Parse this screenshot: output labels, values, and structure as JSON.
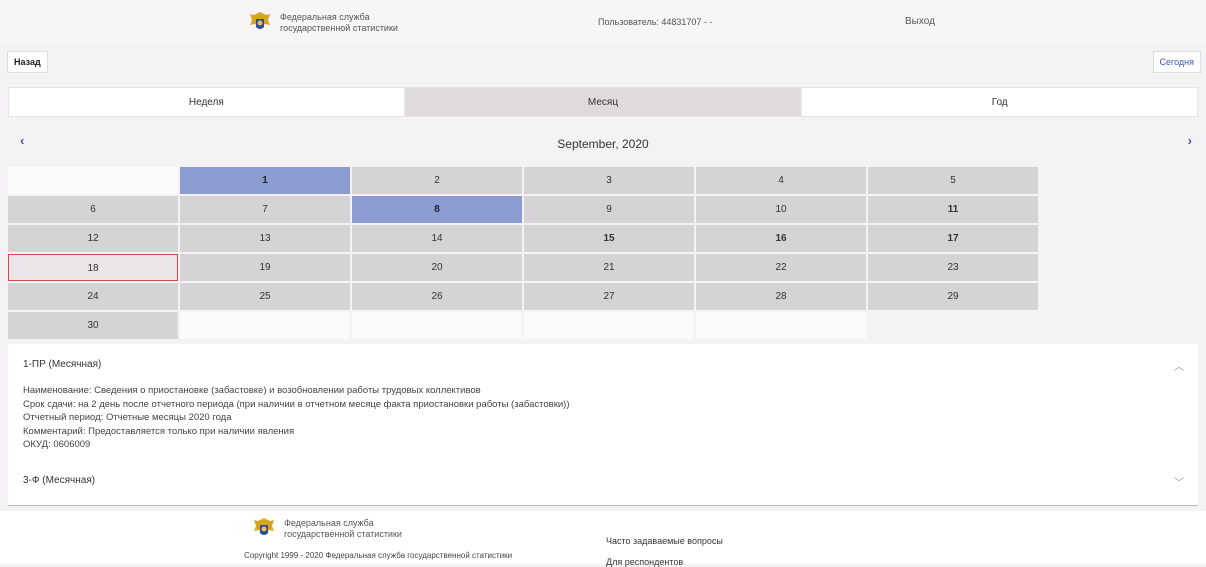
{
  "header": {
    "org_line1": "Федеральная служба",
    "org_line2": "государственной статистики",
    "user_label": "Пользователь: 44831707 - -",
    "logout_label": "Выход"
  },
  "nav": {
    "back_label": "Назад",
    "today_label": "Сегодня"
  },
  "tabs": [
    {
      "label": "Неделя"
    },
    {
      "label": "Месяц"
    },
    {
      "label": "Год"
    }
  ],
  "calendar": {
    "title": "September, 2020",
    "prev_icon": "chevron-left-icon",
    "next_icon": "chevron-right-icon",
    "selected_days": [
      1,
      8
    ],
    "highlighted_day": 18,
    "days": [
      "",
      "1",
      "2",
      "3",
      "4",
      "5",
      "6",
      "7",
      "8",
      "9",
      "10",
      "11",
      "12",
      "13",
      "14",
      "15",
      "16",
      "17",
      "18",
      "19",
      "20",
      "21",
      "22",
      "23",
      "24",
      "25",
      "26",
      "27",
      "28",
      "29",
      "30",
      "",
      "",
      "",
      ""
    ],
    "colors": {
      "selected": "#8c9bd0",
      "today_border": "#d04a4a",
      "day_cell": "#d6d3d6"
    }
  },
  "reports": [
    {
      "title": "1-ПР (Месячная)",
      "expanded": true,
      "lines": [
        "Наименование: Сведения о приостановке (забастовке) и возобновлении работы трудовых коллективов",
        "Срок сдачи: на 2 день после отчетного периода (при наличии в отчетном месяце факта приостановки работы (забастовки))",
        "Отчетный период: Отчетные месяцы 2020 года",
        "Комментарий: Предоставляется только при наличии явления",
        "ОКУД: 0606009"
      ]
    },
    {
      "title": "3-Ф (Месячная)",
      "expanded": false
    }
  ],
  "footer": {
    "org_line1": "Федеральная служба",
    "org_line2": "государственной статистики",
    "copyright": "Copyright 1999 - 2020 Федеральная служба государственной статистики",
    "faq_label": "Часто задаваемые вопросы",
    "respondents_label": "Для респондентов"
  }
}
